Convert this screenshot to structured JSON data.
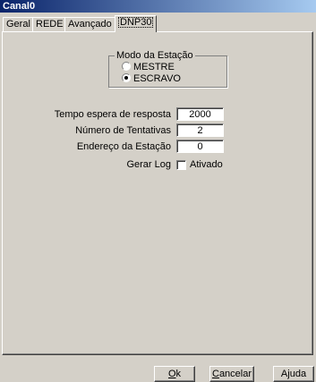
{
  "window": {
    "title": "Canal0"
  },
  "tabs": [
    {
      "label": "Geral"
    },
    {
      "label": "REDE"
    },
    {
      "label": "Avançado"
    },
    {
      "label": "DNP30"
    }
  ],
  "active_tab": "DNP30",
  "station_mode": {
    "title": "Modo da Estação",
    "options": [
      {
        "label": "MESTRE",
        "checked": false
      },
      {
        "label": "ESCRAVO",
        "checked": true
      }
    ]
  },
  "fields": {
    "response_timeout": {
      "label": "Tempo espera de resposta",
      "value": "2000"
    },
    "retries": {
      "label": "Número de Tentativas",
      "value": "2"
    },
    "station_address": {
      "label": "Endereço da Estação",
      "value": "0"
    }
  },
  "log": {
    "label": "Gerar Log",
    "checkbox_label": "Ativado",
    "checked": false
  },
  "buttons": {
    "ok": {
      "label_rest": "k",
      "accel": "O"
    },
    "cancel": {
      "label_rest": "ancelar",
      "accel": "C"
    },
    "help": {
      "label_pre": "A",
      "accel": "j",
      "label_rest": "uda"
    }
  }
}
